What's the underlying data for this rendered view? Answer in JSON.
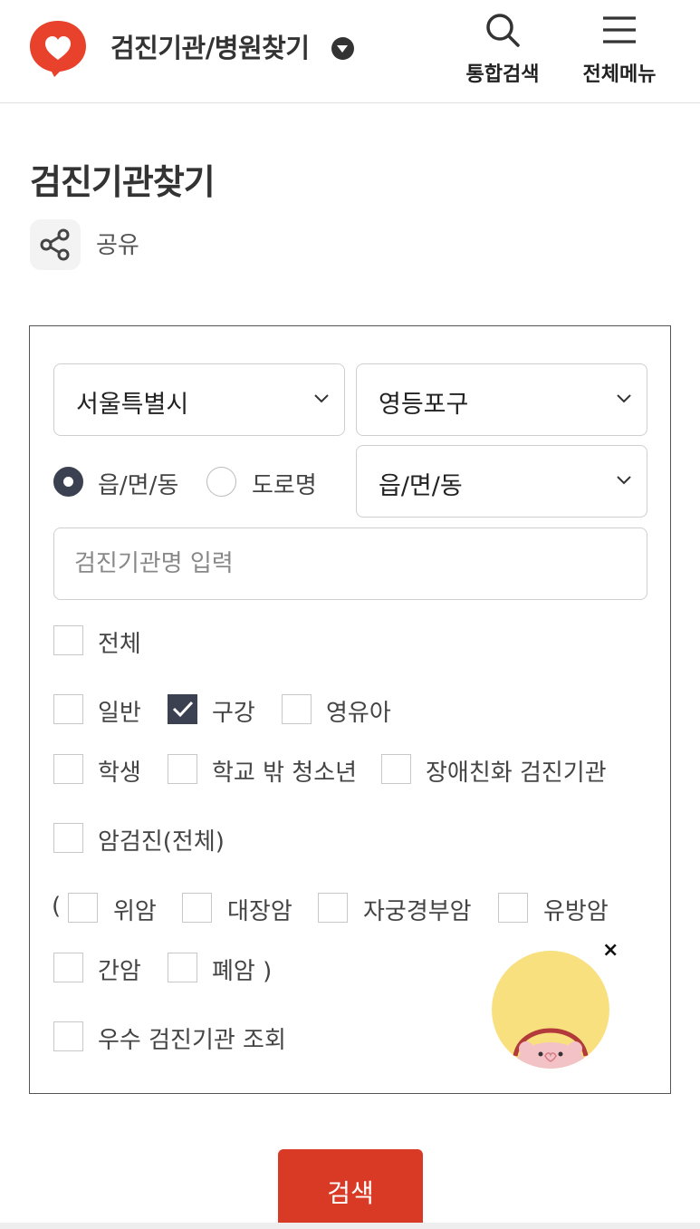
{
  "header": {
    "site_title": "검진기관/병원찾기",
    "search_label": "통합검색",
    "menu_label": "전체메뉴",
    "brand_color": "#e8412c"
  },
  "page": {
    "title": "검진기관찾기",
    "share_label": "공유"
  },
  "form": {
    "region_select": "서울특별시",
    "district_select": "영등포구",
    "address_type": {
      "option_dong": "읍/면/동",
      "option_road": "도로명",
      "selected": "읍/면/동"
    },
    "dong_select": "읍/면/동",
    "name_input": {
      "placeholder": "검진기관명 입력",
      "value": ""
    },
    "checkboxes": {
      "all": {
        "label": "전체",
        "checked": false
      },
      "general": {
        "label": "일반",
        "checked": false
      },
      "oral": {
        "label": "구강",
        "checked": true
      },
      "infant": {
        "label": "영유아",
        "checked": false
      },
      "student": {
        "label": "학생",
        "checked": false
      },
      "out_of_school": {
        "label": "학교 밖 청소년",
        "checked": false
      },
      "disability": {
        "label": "장애친화 검진기관",
        "checked": false
      },
      "cancer_all": {
        "label": "암검진(전체)",
        "checked": false
      },
      "stomach": {
        "label": "위암",
        "checked": false
      },
      "colon": {
        "label": "대장암",
        "checked": false
      },
      "cervical": {
        "label": "자궁경부암",
        "checked": false
      },
      "breast": {
        "label": "유방암",
        "checked": false
      },
      "liver": {
        "label": "간암",
        "checked": false
      },
      "lung": {
        "label": "폐암 )",
        "checked": false
      },
      "excellent": {
        "label": "우수 검진기관 조회",
        "checked": false
      }
    },
    "paren_open": "(",
    "close_symbol": "×"
  },
  "search_button": {
    "label": "검색",
    "color": "#d83a26"
  }
}
